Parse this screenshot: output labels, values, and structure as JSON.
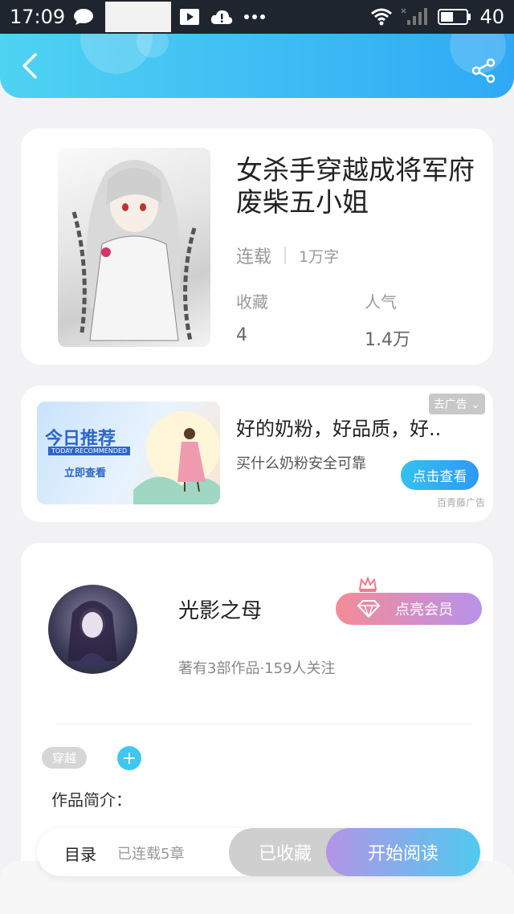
{
  "status": {
    "time": "17:09",
    "battery": "40"
  },
  "book": {
    "title": "女杀手穿越成将军府废柴五小姐",
    "status_label": "连载",
    "words": "1万字",
    "stats": [
      {
        "label": "收藏",
        "value": "4"
      },
      {
        "label": "人气",
        "value": "1.4万"
      }
    ]
  },
  "ad": {
    "title": "好的奶粉，好品质，好..",
    "subtitle": "买什么奶粉安全可靠",
    "tag": "去广告",
    "button": "点击查看",
    "source": "百青藤广告",
    "image_title": "今日推荐",
    "image_en": "TODAY RECOMMENDED",
    "image_cta": "立即查看"
  },
  "author": {
    "name": "光影之母",
    "info": "著有3部作品·159人关注",
    "vip_button": "点亮会员"
  },
  "tags": [
    "穿越"
  ],
  "intro_title": "作品简介：",
  "bottom": {
    "catalog": "目录",
    "chapters": "已连载5章",
    "collected": "已收藏",
    "start": "开始阅读"
  },
  "colors": {
    "accent": "#33c2ee",
    "header_start": "#4fd3f2",
    "header_end": "#2fa9f5"
  }
}
